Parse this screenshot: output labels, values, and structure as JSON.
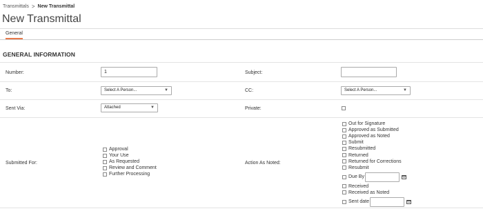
{
  "breadcrumb": {
    "parent": "Transmittals",
    "separator": ">",
    "current": "New Transmittal"
  },
  "page": {
    "title": "New Transmittal"
  },
  "tabs": [
    {
      "label": "General",
      "active": true
    }
  ],
  "section": {
    "title": "GENERAL INFORMATION"
  },
  "form": {
    "number": {
      "label": "Number:",
      "value": "1"
    },
    "subject": {
      "label": "Subject:",
      "value": ""
    },
    "to": {
      "label": "To:",
      "selected": "Select A Person..."
    },
    "cc": {
      "label": "CC:",
      "selected": "Select A Person..."
    },
    "sent_via": {
      "label": "Sent Via:",
      "selected": "Attached"
    },
    "private": {
      "label": "Private:",
      "checked": false
    },
    "submitted_for": {
      "label": "Submitted For:",
      "options": [
        "Approval",
        "Your Use",
        "As Requested",
        "Review and Comment",
        "Further Processing"
      ]
    },
    "action_as_noted": {
      "label": "Action As Noted:",
      "options": [
        "Out for Signature",
        "Approved as Submitted",
        "Approved as Noted",
        "Submit",
        "Resubmitted",
        "Returned",
        "Returned for Corrections",
        "Resubmit"
      ],
      "due_by": "Due By",
      "received_options": [
        "Received",
        "Received as Noted"
      ],
      "sent_date": "Sent date"
    }
  },
  "icons": {
    "calendar": "calendar-icon",
    "caret": "chevron-down-icon",
    "breadcrumb_separator": "chevron-right-icon"
  },
  "colors": {
    "tab_underline": "#e8794a"
  }
}
